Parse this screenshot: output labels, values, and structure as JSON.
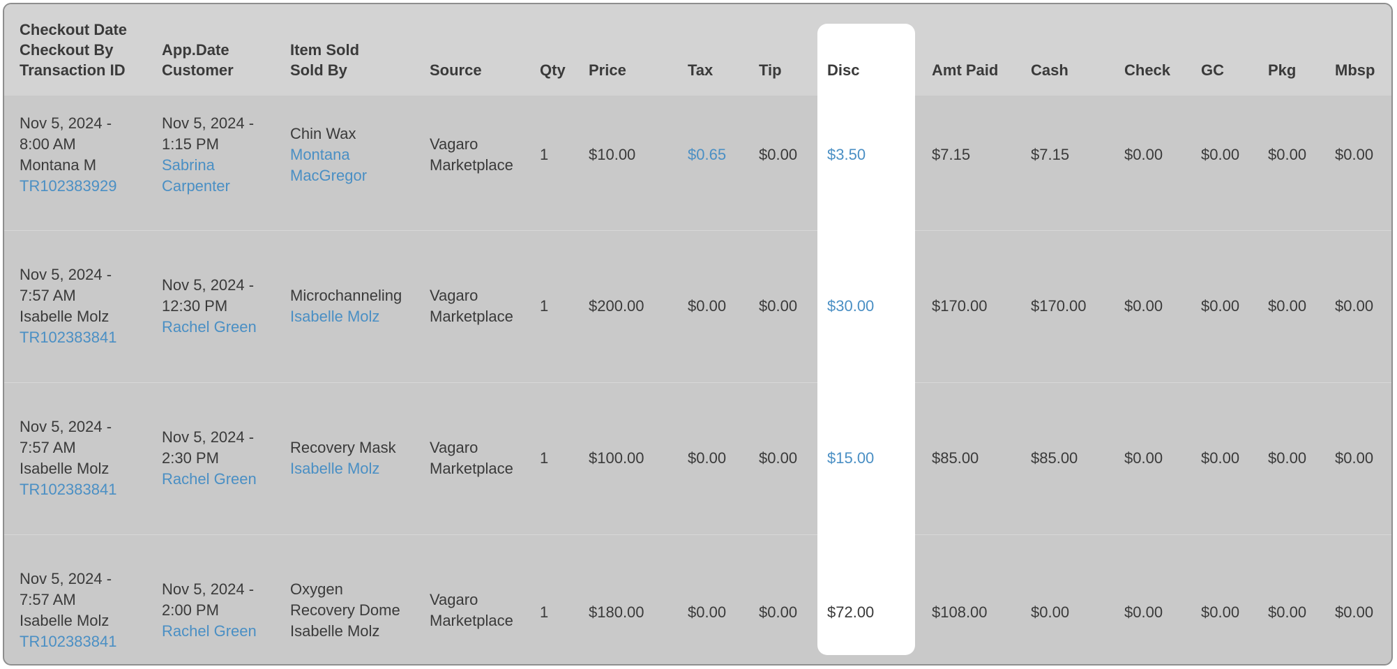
{
  "headers": {
    "col1": [
      "Checkout Date",
      "Checkout By",
      "Transaction ID"
    ],
    "col2": [
      "App.Date",
      "Customer"
    ],
    "col3": [
      "Item Sold",
      "Sold By"
    ],
    "source": "Source",
    "qty": "Qty",
    "price": "Price",
    "tax": "Tax",
    "tip": "Tip",
    "disc": "Disc",
    "amt_paid": "Amt Paid",
    "cash": "Cash",
    "check": "Check",
    "gc": "GC",
    "pkg": "Pkg",
    "mbsp": "Mbsp"
  },
  "rows": [
    {
      "checkout_date": [
        "Nov 5, 2024 -",
        "8:00 AM"
      ],
      "checkout_by": "Montana M",
      "transaction_id": "TR102383929",
      "app_date": [
        "Nov 5, 2024 -",
        "1:15 PM"
      ],
      "customer": [
        "Sabrina",
        "Carpenter"
      ],
      "item_sold": [
        "Chin Wax"
      ],
      "sold_by": [
        "Montana",
        "MacGregor"
      ],
      "source": [
        "Vagaro",
        "Marketplace"
      ],
      "qty": "1",
      "price": "$10.00",
      "tax": "$0.65",
      "tip": "$0.00",
      "disc": "$3.50",
      "amt_paid": "$7.15",
      "cash": "$7.15",
      "check": "$0.00",
      "gc": "$0.00",
      "pkg": "$0.00",
      "mbsp": "$0.00"
    },
    {
      "checkout_date": [
        "Nov 5, 2024 -",
        "7:57 AM"
      ],
      "checkout_by": "Isabelle Molz",
      "transaction_id": "TR102383841",
      "app_date": [
        "Nov 5, 2024 -",
        "12:30 PM"
      ],
      "customer": [
        "Rachel Green"
      ],
      "item_sold": [
        "Microchanneling"
      ],
      "sold_by": [
        "Isabelle Molz"
      ],
      "source": [
        "Vagaro",
        "Marketplace"
      ],
      "qty": "1",
      "price": "$200.00",
      "tax": "$0.00",
      "tip": "$0.00",
      "disc": "$30.00",
      "amt_paid": "$170.00",
      "cash": "$170.00",
      "check": "$0.00",
      "gc": "$0.00",
      "pkg": "$0.00",
      "mbsp": "$0.00"
    },
    {
      "checkout_date": [
        "Nov 5, 2024 -",
        "7:57 AM"
      ],
      "checkout_by": "Isabelle Molz",
      "transaction_id": "TR102383841",
      "app_date": [
        "Nov 5, 2024 -",
        "2:30 PM"
      ],
      "customer": [
        "Rachel Green"
      ],
      "item_sold": [
        "Recovery Mask"
      ],
      "sold_by": [
        "Isabelle Molz"
      ],
      "source": [
        "Vagaro",
        "Marketplace"
      ],
      "qty": "1",
      "price": "$100.00",
      "tax": "$0.00",
      "tip": "$0.00",
      "disc": "$15.00",
      "amt_paid": "$85.00",
      "cash": "$85.00",
      "check": "$0.00",
      "gc": "$0.00",
      "pkg": "$0.00",
      "mbsp": "$0.00"
    },
    {
      "checkout_date": [
        "Nov 5, 2024 -",
        "7:57 AM"
      ],
      "checkout_by": "Isabelle Molz",
      "transaction_id": "TR102383841",
      "app_date": [
        "Nov 5, 2024 -",
        "2:00 PM"
      ],
      "customer": [
        "Rachel Green"
      ],
      "item_sold": [
        "Oxygen",
        "Recovery Dome",
        "Isabelle Molz"
      ],
      "sold_by": [],
      "source": [
        "Vagaro",
        "Marketplace"
      ],
      "qty": "1",
      "price": "$180.00",
      "tax": "$0.00",
      "tip": "$0.00",
      "disc": "$72.00",
      "amt_paid": "$108.00",
      "cash": "$0.00",
      "check": "$0.00",
      "gc": "$0.00",
      "pkg": "$0.00",
      "mbsp": "$0.00"
    }
  ],
  "colors": {
    "link": "#4a8fc4",
    "text": "#3a3a3a",
    "dim_background": "#c9c9c9",
    "header_background": "#d3d3d3",
    "highlight": "#ffffff"
  }
}
